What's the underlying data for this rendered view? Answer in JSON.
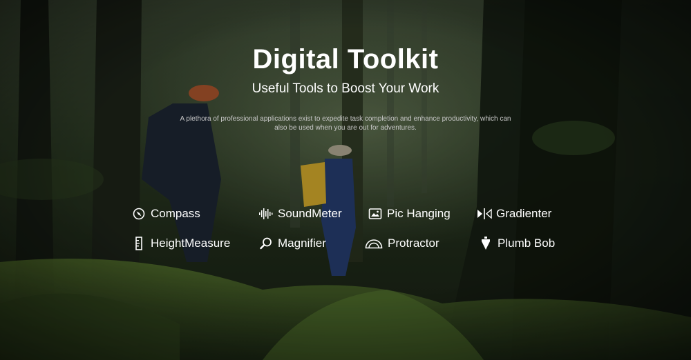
{
  "hero": {
    "title": "Digital Toolkit",
    "subtitle": "Useful Tools to Boost Your Work",
    "description": "A plethora of professional applications exist to expedite task completion and enhance productivity, which can also be used when you are out for adventures."
  },
  "tools": [
    {
      "label": "Compass",
      "icon": "compass-icon"
    },
    {
      "label": "SoundMeter",
      "icon": "sound-wave-icon"
    },
    {
      "label": "Pic Hanging",
      "icon": "picture-frame-icon"
    },
    {
      "label": "Gradienter",
      "icon": "level-icon"
    },
    {
      "label": "HeightMeasure",
      "icon": "ruler-icon"
    },
    {
      "label": "Magnifier",
      "icon": "magnifier-icon"
    },
    {
      "label": "Protractor",
      "icon": "protractor-icon"
    },
    {
      "label": "Plumb Bob",
      "icon": "plumb-bob-icon"
    }
  ],
  "colors": {
    "text": "#ffffff",
    "description": "#c9c9c9",
    "forest_dark": "#141b12",
    "moss": "#4c6a2a"
  }
}
